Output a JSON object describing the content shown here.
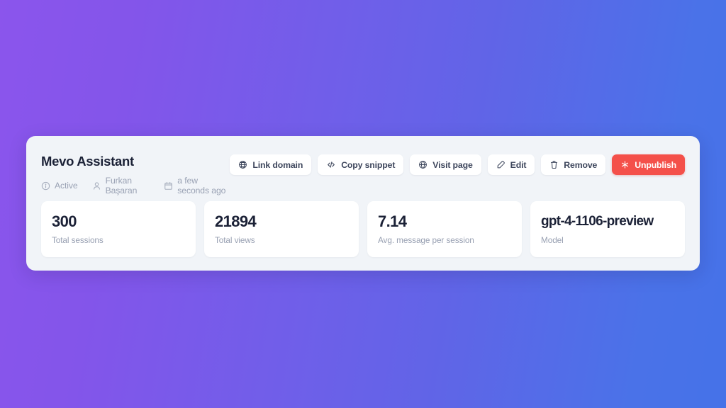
{
  "theme": {
    "gradient_start": "#8b55ec",
    "gradient_end": "#4572e8",
    "panel_bg": "#f1f4f8",
    "card_bg": "#ffffff",
    "text_dark": "#1b2136",
    "text_muted": "#98a0b2",
    "danger": "#f4504a"
  },
  "header": {
    "title": "Mevo Assistant",
    "meta": [
      {
        "icon": "info-circle-icon",
        "label": "Active"
      },
      {
        "icon": "user-icon",
        "label": "Furkan Başaran"
      },
      {
        "icon": "calendar-icon",
        "label": "a few seconds ago"
      }
    ]
  },
  "actions": [
    {
      "icon": "globe-network-icon",
      "label": "Link domain",
      "variant": "default"
    },
    {
      "icon": "code-brackets-icon",
      "label": "Copy snippet",
      "variant": "default"
    },
    {
      "icon": "globe-icon",
      "label": "Visit page",
      "variant": "default"
    },
    {
      "icon": "pencil-edit-icon",
      "label": "Edit",
      "variant": "default"
    },
    {
      "icon": "trash-icon",
      "label": "Remove",
      "variant": "default"
    },
    {
      "icon": "unpublish-star-icon",
      "label": "Unpublish",
      "variant": "danger"
    }
  ],
  "stats": [
    {
      "value": "300",
      "label": "Total sessions"
    },
    {
      "value": "21894",
      "label": "Total views"
    },
    {
      "value": "7.14",
      "label": "Avg. message per session"
    },
    {
      "value": "gpt-4-1106-preview",
      "label": "Model"
    }
  ]
}
